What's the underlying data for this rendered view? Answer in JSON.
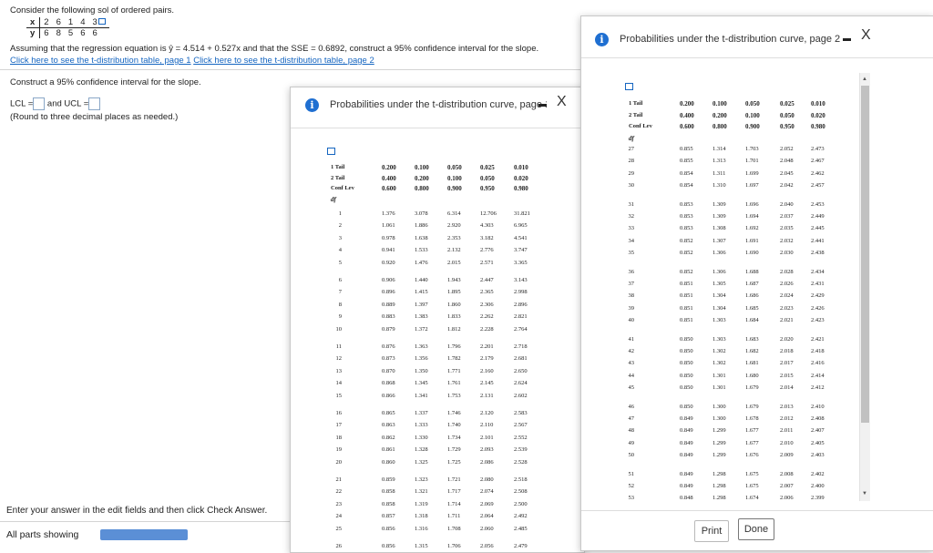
{
  "question": {
    "prompt": "Consider the following sol of ordered pairs.",
    "x_label": "x",
    "y_label": "y",
    "x_values": [
      "2",
      "6",
      "1",
      "4",
      "3"
    ],
    "y_values": [
      "6",
      "8",
      "5",
      "6",
      "6"
    ],
    "assumption": "Assuming that the regression equation is ŷ = 4.514 + 0.527x and that the SSE = 0.6892, construct a 95% confidence interval for the slope.",
    "link1": "Click here to see the t-distribution table, page 1",
    "link2": "Click here to see the t-distribution table, page 2",
    "task": "Construct a 95% confidence interval for the slope.",
    "lcl_label": "LCL =",
    "ucl_label": "and UCL =",
    "round_note": "(Round to three decimal places as needed.)"
  },
  "footer": {
    "instruction": "Enter your answer in the edit fields and then click Check Answer.",
    "parts": "All parts showing"
  },
  "popup1": {
    "title": "Probabilities under the t-distribution curve, page 1",
    "close": "X"
  },
  "popup2": {
    "title": "Probabilities under the t-distribution curve, page 2",
    "close": "X",
    "print_label": "Print",
    "done_label": "Done"
  },
  "table_header": {
    "one_tail": "1 Tail",
    "two_tail": "2 Tail",
    "conf_lev": "Conf Lev",
    "df": "df",
    "one_tail_vals": [
      "0.200",
      "0.100",
      "0.050",
      "0.025",
      "0.010"
    ],
    "two_tail_vals": [
      "0.400",
      "0.200",
      "0.100",
      "0.050",
      "0.020"
    ],
    "conf_vals": [
      "0.600",
      "0.800",
      "0.900",
      "0.950",
      "0.980"
    ]
  },
  "table1_rows": [
    [
      "1",
      "1.376",
      "3.078",
      "6.314",
      "12.706",
      "31.821"
    ],
    [
      "2",
      "1.061",
      "1.886",
      "2.920",
      "4.303",
      "6.965"
    ],
    [
      "3",
      "0.978",
      "1.638",
      "2.353",
      "3.182",
      "4.541"
    ],
    [
      "4",
      "0.941",
      "1.533",
      "2.132",
      "2.776",
      "3.747"
    ],
    [
      "5",
      "0.920",
      "1.476",
      "2.015",
      "2.571",
      "3.365"
    ],
    [
      "6",
      "0.906",
      "1.440",
      "1.943",
      "2.447",
      "3.143"
    ],
    [
      "7",
      "0.896",
      "1.415",
      "1.895",
      "2.365",
      "2.998"
    ],
    [
      "8",
      "0.889",
      "1.397",
      "1.860",
      "2.306",
      "2.896"
    ],
    [
      "9",
      "0.883",
      "1.383",
      "1.833",
      "2.262",
      "2.821"
    ],
    [
      "10",
      "0.879",
      "1.372",
      "1.812",
      "2.228",
      "2.764"
    ],
    [
      "11",
      "0.876",
      "1.363",
      "1.796",
      "2.201",
      "2.718"
    ],
    [
      "12",
      "0.873",
      "1.356",
      "1.782",
      "2.179",
      "2.681"
    ],
    [
      "13",
      "0.870",
      "1.350",
      "1.771",
      "2.160",
      "2.650"
    ],
    [
      "14",
      "0.868",
      "1.345",
      "1.761",
      "2.145",
      "2.624"
    ],
    [
      "15",
      "0.866",
      "1.341",
      "1.753",
      "2.131",
      "2.602"
    ],
    [
      "16",
      "0.865",
      "1.337",
      "1.746",
      "2.120",
      "2.583"
    ],
    [
      "17",
      "0.863",
      "1.333",
      "1.740",
      "2.110",
      "2.567"
    ],
    [
      "18",
      "0.862",
      "1.330",
      "1.734",
      "2.101",
      "2.552"
    ],
    [
      "19",
      "0.861",
      "1.328",
      "1.729",
      "2.093",
      "2.539"
    ],
    [
      "20",
      "0.860",
      "1.325",
      "1.725",
      "2.086",
      "2.528"
    ],
    [
      "21",
      "0.859",
      "1.323",
      "1.721",
      "2.080",
      "2.518"
    ],
    [
      "22",
      "0.858",
      "1.321",
      "1.717",
      "2.074",
      "2.508"
    ],
    [
      "23",
      "0.858",
      "1.319",
      "1.714",
      "2.069",
      "2.500"
    ],
    [
      "24",
      "0.857",
      "1.318",
      "1.711",
      "2.064",
      "2.492"
    ],
    [
      "25",
      "0.856",
      "1.316",
      "1.708",
      "2.060",
      "2.485"
    ],
    [
      "26",
      "0.856",
      "1.315",
      "1.706",
      "2.056",
      "2.479"
    ]
  ],
  "table2_rows": [
    [
      "27",
      "0.855",
      "1.314",
      "1.703",
      "2.052",
      "2.473"
    ],
    [
      "28",
      "0.855",
      "1.313",
      "1.701",
      "2.048",
      "2.467"
    ],
    [
      "29",
      "0.854",
      "1.311",
      "1.699",
      "2.045",
      "2.462"
    ],
    [
      "30",
      "0.854",
      "1.310",
      "1.697",
      "2.042",
      "2.457"
    ],
    [
      "31",
      "0.853",
      "1.309",
      "1.696",
      "2.040",
      "2.453"
    ],
    [
      "32",
      "0.853",
      "1.309",
      "1.694",
      "2.037",
      "2.449"
    ],
    [
      "33",
      "0.853",
      "1.308",
      "1.692",
      "2.035",
      "2.445"
    ],
    [
      "34",
      "0.852",
      "1.307",
      "1.691",
      "2.032",
      "2.441"
    ],
    [
      "35",
      "0.852",
      "1.306",
      "1.690",
      "2.030",
      "2.438"
    ],
    [
      "36",
      "0.852",
      "1.306",
      "1.688",
      "2.028",
      "2.434"
    ],
    [
      "37",
      "0.851",
      "1.305",
      "1.687",
      "2.026",
      "2.431"
    ],
    [
      "38",
      "0.851",
      "1.304",
      "1.686",
      "2.024",
      "2.429"
    ],
    [
      "39",
      "0.851",
      "1.304",
      "1.685",
      "2.023",
      "2.426"
    ],
    [
      "40",
      "0.851",
      "1.303",
      "1.684",
      "2.021",
      "2.423"
    ],
    [
      "41",
      "0.850",
      "1.303",
      "1.683",
      "2.020",
      "2.421"
    ],
    [
      "42",
      "0.850",
      "1.302",
      "1.682",
      "2.018",
      "2.418"
    ],
    [
      "43",
      "0.850",
      "1.302",
      "1.681",
      "2.017",
      "2.416"
    ],
    [
      "44",
      "0.850",
      "1.301",
      "1.680",
      "2.015",
      "2.414"
    ],
    [
      "45",
      "0.850",
      "1.301",
      "1.679",
      "2.014",
      "2.412"
    ],
    [
      "46",
      "0.850",
      "1.300",
      "1.679",
      "2.013",
      "2.410"
    ],
    [
      "47",
      "0.849",
      "1.300",
      "1.678",
      "2.012",
      "2.408"
    ],
    [
      "48",
      "0.849",
      "1.299",
      "1.677",
      "2.011",
      "2.407"
    ],
    [
      "49",
      "0.849",
      "1.299",
      "1.677",
      "2.010",
      "2.405"
    ],
    [
      "50",
      "0.849",
      "1.299",
      "1.676",
      "2.009",
      "2.403"
    ],
    [
      "51",
      "0.849",
      "1.298",
      "1.675",
      "2.008",
      "2.402"
    ],
    [
      "52",
      "0.849",
      "1.298",
      "1.675",
      "2.007",
      "2.400"
    ],
    [
      "53",
      "0.848",
      "1.298",
      "1.674",
      "2.006",
      "2.399"
    ]
  ]
}
